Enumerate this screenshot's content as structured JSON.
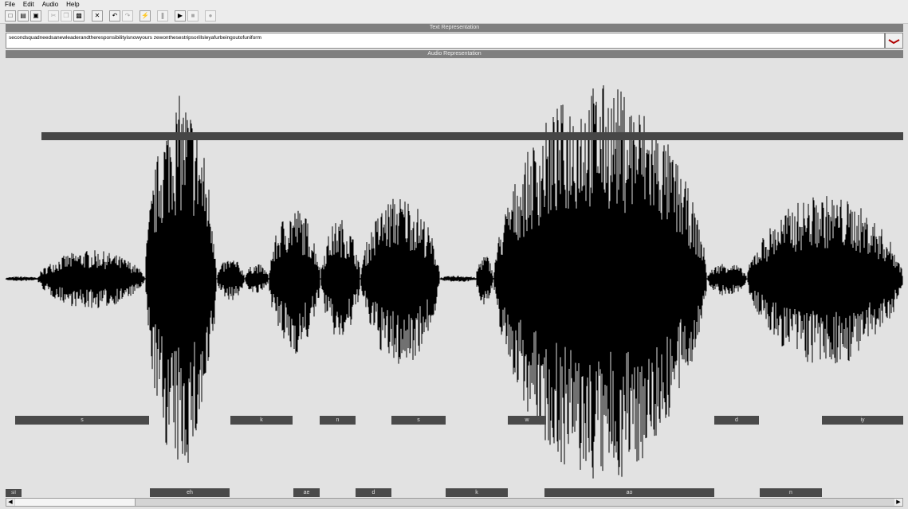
{
  "menu": {
    "file": "File",
    "edit": "Edit",
    "audio": "Audio",
    "help": "Help"
  },
  "toolbar": {
    "icons": [
      "new-icon",
      "open-icon",
      "save-icon",
      "cut-icon",
      "copy-icon",
      "paste-icon",
      "delete-icon",
      "undo-icon",
      "redo-icon",
      "run-icon",
      "pause-icon",
      "play-icon",
      "stop-icon",
      "record-icon"
    ]
  },
  "text_section": {
    "header": "Text Representation",
    "value": "secondsquadneedsanewleaderandtheresponsibilityisnowyours zewonthesestripsorillsleyafurbeingoutofuniform"
  },
  "audio_section": {
    "header": "Audio Representation"
  },
  "phones_row1": [
    "s",
    "k",
    "n",
    "s",
    "w",
    "d",
    "iy"
  ],
  "phones_row2": [
    "eh",
    "ae",
    "d",
    "k",
    "ao",
    "n"
  ],
  "bottom_label": "sil",
  "colors": {
    "header": "#7f7f7f",
    "bar": "#464646",
    "background": "#e2e2e2",
    "wave": "#000000"
  }
}
